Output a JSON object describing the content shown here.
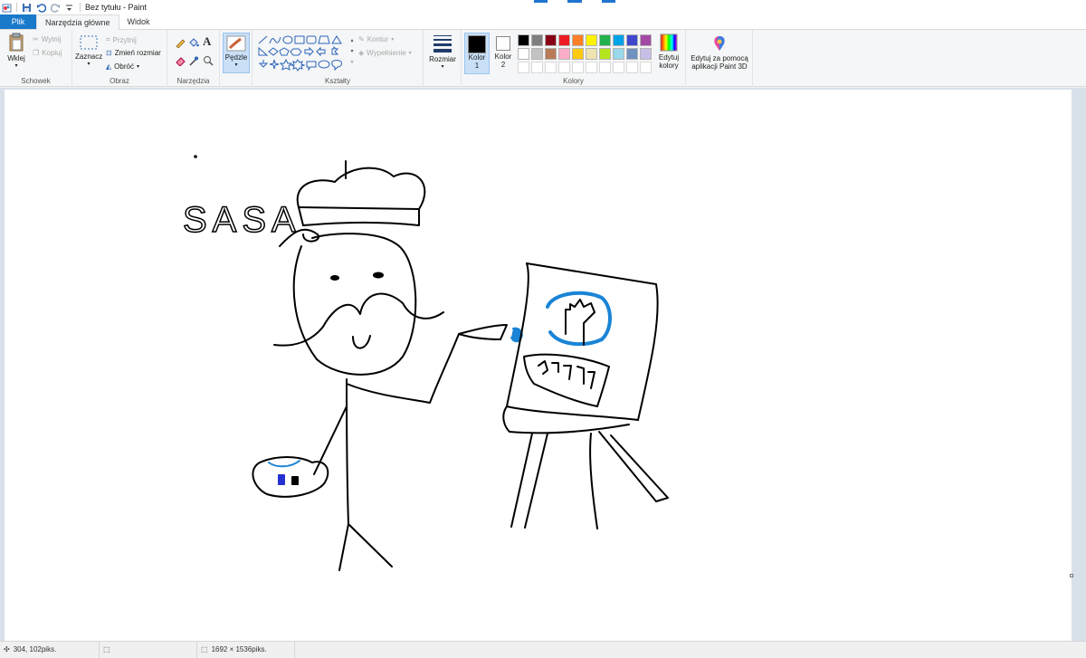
{
  "title_bar": {
    "title": "Bez tytułu - Paint"
  },
  "tabs": {
    "file": "Plik",
    "home": "Narzędzia główne",
    "view": "Widok"
  },
  "clipboard": {
    "paste": "Wklej",
    "cut": "Wytnij",
    "copy": "Kopiuj",
    "label": "Schowek"
  },
  "image": {
    "select": "Zaznacz",
    "crop": "Przytnij",
    "resize": "Zmień rozmiar",
    "rotate": "Obróć",
    "label": "Obraz"
  },
  "tools": {
    "label": "Narzędzia"
  },
  "brushes": {
    "label": "Pędzle"
  },
  "shapes": {
    "outline": "Kontur",
    "fill": "Wypełnienie",
    "label": "Kształty"
  },
  "size": {
    "label": "Rozmiar"
  },
  "colors": {
    "color1": "Kolor 1",
    "color1_a": "Kolor",
    "color1_b": "1",
    "color2_a": "Kolor",
    "color2_b": "2",
    "edit_a": "Edytuj",
    "edit_b": "kolory",
    "label": "Kolory",
    "palette_row1": [
      "#000000",
      "#7f7f7f",
      "#880015",
      "#ed1c24",
      "#ff7f27",
      "#fff200",
      "#22b14c",
      "#00a2e8",
      "#3f48cc",
      "#a349a4"
    ],
    "palette_row2": [
      "#ffffff",
      "#c3c3c3",
      "#b97a57",
      "#ffaec9",
      "#ffc90e",
      "#efe4b0",
      "#b5e61d",
      "#99d9ea",
      "#7092be",
      "#c8bfe7"
    ],
    "color1_value": "#000000",
    "color2_value": "#ffffff"
  },
  "paint3d": {
    "line1": "Edytuj za pomocą",
    "line2": "aplikacji Paint 3D"
  },
  "drawing": {
    "text": "SASA"
  },
  "status": {
    "cursor": "304, 102piks.",
    "size": "1692 × 1536piks."
  }
}
